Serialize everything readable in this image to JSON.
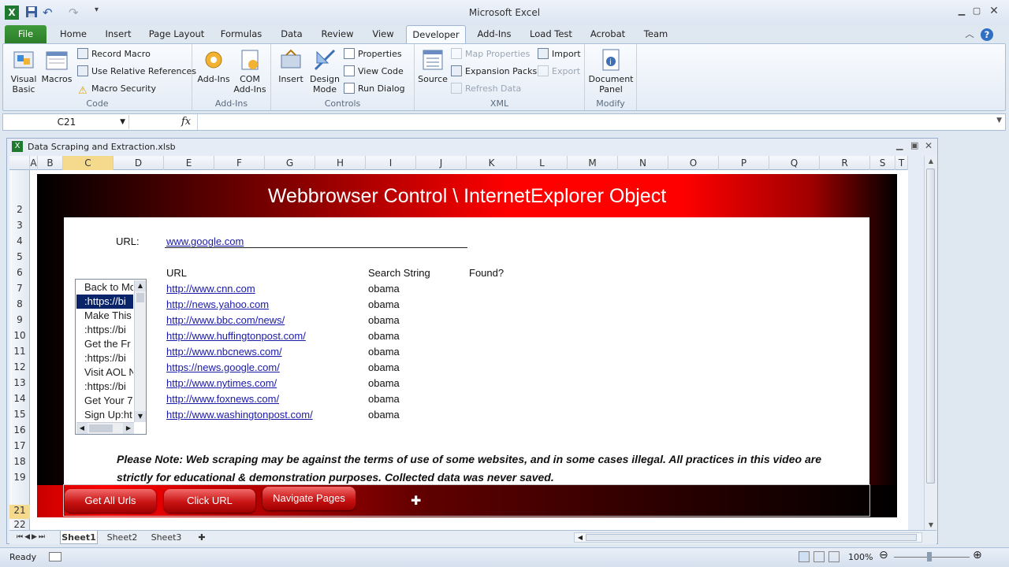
{
  "app": {
    "title": "Microsoft Excel"
  },
  "tabs": [
    "File",
    "Home",
    "Insert",
    "Page Layout",
    "Formulas",
    "Data",
    "Review",
    "View",
    "Developer",
    "Add-Ins",
    "Load Test",
    "Acrobat",
    "Team"
  ],
  "ribbon": {
    "code": {
      "label": "Code",
      "visual_basic": "Visual Basic",
      "macros": "Macros",
      "record_macro": "Record Macro",
      "relative_refs": "Use Relative References",
      "macro_security": "Macro Security"
    },
    "addins": {
      "label": "Add-Ins",
      "addins": "Add-Ins",
      "com_addins": "COM Add-Ins"
    },
    "controls": {
      "label": "Controls",
      "insert": "Insert",
      "design_mode": "Design Mode",
      "properties": "Properties",
      "view_code": "View Code",
      "run_dialog": "Run Dialog"
    },
    "xml": {
      "label": "XML",
      "source": "Source",
      "map_properties": "Map Properties",
      "expansion_packs": "Expansion Packs",
      "refresh_data": "Refresh Data",
      "import": "Import",
      "export": "Export"
    },
    "modify": {
      "label": "Modify",
      "document_panel": "Document Panel"
    }
  },
  "formula_bar": {
    "name_box": "C21",
    "fx": "fx",
    "value": ""
  },
  "workbook": {
    "title": "Data Scraping and Extraction.xlsb"
  },
  "columns": [
    "A",
    "B",
    "C",
    "D",
    "E",
    "F",
    "G",
    "H",
    "I",
    "J",
    "K",
    "L",
    "M",
    "N",
    "O",
    "P",
    "Q",
    "R",
    "S",
    "T"
  ],
  "rows": [
    "2",
    "3",
    "4",
    "5",
    "6",
    "7",
    "8",
    "9",
    "10",
    "11",
    "12",
    "13",
    "14",
    "15",
    "16",
    "17",
    "18",
    "19",
    "21",
    "22"
  ],
  "dashboard": {
    "title": "Webbrowser Control \\ InternetExplorer Object",
    "url_label": "URL:",
    "url_value": "www.google.com",
    "headers": {
      "url": "URL",
      "search": "Search String",
      "found": "Found?"
    },
    "sites": [
      {
        "url": "http://www.cnn.com",
        "search": "obama"
      },
      {
        "url": "http://news.yahoo.com",
        "search": "obama"
      },
      {
        "url": "http://www.bbc.com/news/",
        "search": "obama"
      },
      {
        "url": "http://www.huffingtonpost.com/",
        "search": "obama"
      },
      {
        "url": "http://www.nbcnews.com/",
        "search": "obama"
      },
      {
        "url": "https://news.google.com/",
        "search": "obama"
      },
      {
        "url": "http://www.nytimes.com/",
        "search": "obama"
      },
      {
        "url": "http://www.foxnews.com/",
        "search": "obama"
      },
      {
        "url": "http://www.washingtonpost.com/",
        "search": "obama"
      }
    ],
    "listbox": [
      "Back to Mo",
      ":https://bi",
      "Make This",
      ":https://bi",
      "Get the Fr",
      ":https://bi",
      "Visit AOL N",
      ":https://bi",
      "Get Your 7",
      "Sign Up:ht"
    ],
    "note": "Please Note: Web scraping may be against the terms of use of some websites, and in some cases illegal. All practices in this video are strictly for educational & demonstration purposes. Collected data was never saved.",
    "buttons": {
      "get_all_urls": "Get All Urls",
      "click_url": "Click URL",
      "navigate_pages": "Navigate Pages"
    }
  },
  "sheets": [
    "Sheet1",
    "Sheet2",
    "Sheet3"
  ],
  "status": {
    "ready": "Ready",
    "zoom": "100%"
  }
}
